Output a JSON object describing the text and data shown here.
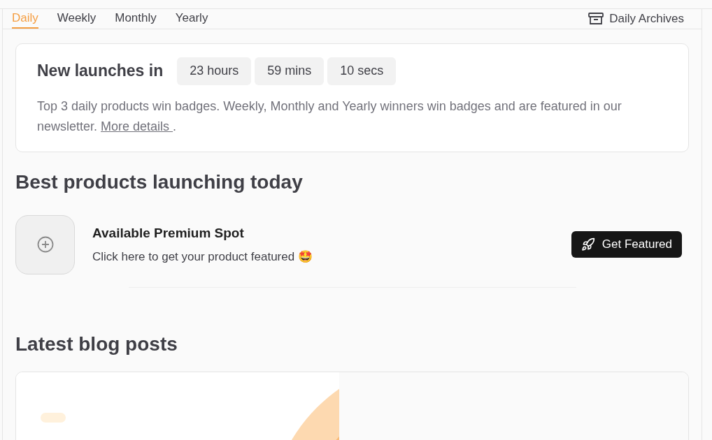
{
  "tabs": [
    {
      "label": "Daily",
      "selected": true
    },
    {
      "label": "Weekly",
      "selected": false
    },
    {
      "label": "Monthly",
      "selected": false
    },
    {
      "label": "Yearly",
      "selected": false
    }
  ],
  "archives_link": "Daily Archives",
  "countdown": {
    "title": "New launches in",
    "units": [
      "23 hours",
      "59 mins",
      "10 secs"
    ],
    "description": "Top 3 daily products win badges. Weekly, Monthly and Yearly winners win badges and are featured in our newsletter. ",
    "link": "More details ",
    "after_link": "."
  },
  "products": {
    "heading": "Best products launching today",
    "spot": {
      "title": "Available Premium Spot",
      "subtitle": "Click here to get your product featured 🤩",
      "button": "Get Featured"
    }
  },
  "blog": {
    "heading": "Latest blog posts"
  }
}
